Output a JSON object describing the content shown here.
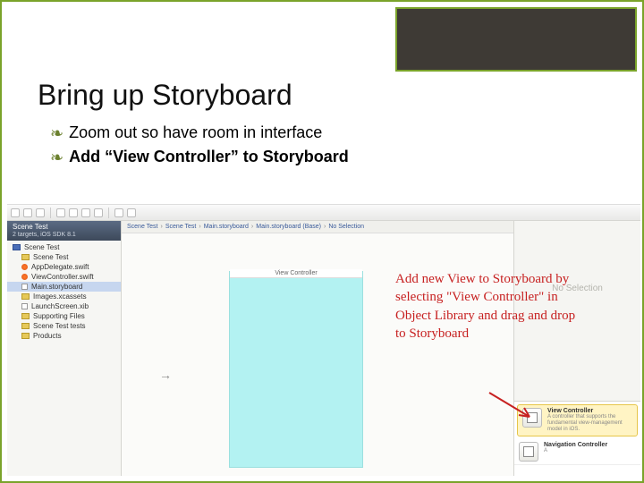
{
  "slide": {
    "title": "Bring up Storyboard",
    "bullets": [
      {
        "text": "Zoom out so have room in interface",
        "bold": false
      },
      {
        "text": "Add “View Controller” to Storyboard",
        "bold": true
      }
    ]
  },
  "annotation": "Add new View to Storyboard by selecting \"View Controller\" in Object Library and drag and drop to Storyboard",
  "xcode": {
    "breadcrumbs": [
      "Scene Test",
      "Scene Test",
      "Main.storyboard",
      "Main.storyboard (Base)",
      "No Selection"
    ],
    "project_name": "Scene Test",
    "project_sub": "2 targets, iOS SDK 8.1",
    "tree": [
      {
        "label": "Scene Test",
        "kind": "bluefold",
        "root": true
      },
      {
        "label": "Scene Test",
        "kind": "yellow"
      },
      {
        "label": "AppDelegate.swift",
        "kind": "swift"
      },
      {
        "label": "ViewController.swift",
        "kind": "swift"
      },
      {
        "label": "Main.storyboard",
        "kind": "sb",
        "selected": true
      },
      {
        "label": "Images.xcassets",
        "kind": "yellow"
      },
      {
        "label": "LaunchScreen.xib",
        "kind": "sb"
      },
      {
        "label": "Supporting Files",
        "kind": "yellow"
      },
      {
        "label": "Scene Test tests",
        "kind": "yellow"
      },
      {
        "label": "Products",
        "kind": "yellow"
      }
    ],
    "canvas_title": "View Controller",
    "no_selection": "No Selection",
    "object_library": [
      {
        "name": "View Controller",
        "desc": "A controller that supports the fundamental view-management model in iOS."
      },
      {
        "name": "Navigation Controller",
        "desc": "A"
      }
    ]
  }
}
